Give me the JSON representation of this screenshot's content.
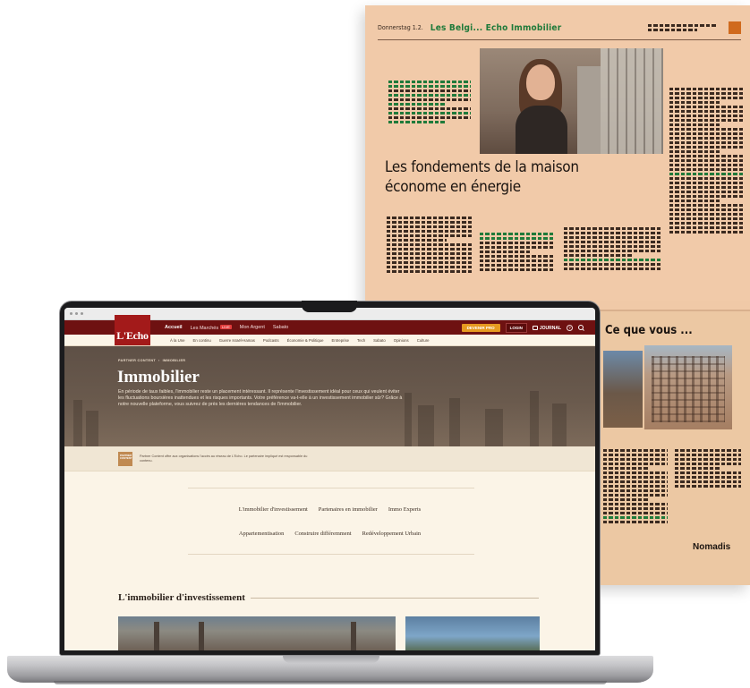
{
  "newspaper": {
    "folio": "Donnerstag 1.2.",
    "kicker": "Les Belgi... Echo Immobilier",
    "headline_line1": "Les fondements de la maison",
    "headline_line2": "économe en énergie",
    "page2_heading": "Ce que vous ...",
    "page2_logo": "Nomadis"
  },
  "browser": {
    "site": {
      "logo": "L'Echo",
      "nav_primary": [
        {
          "label": "Accueil",
          "active": true
        },
        {
          "label": "Les Marchés",
          "badge": "LIVE"
        },
        {
          "label": "Mon Argent"
        },
        {
          "label": "Sabato"
        }
      ],
      "subscribe_label": "DEVENIR PRO",
      "login_label": "LOGIN",
      "journal_label": "JOURNAL",
      "nav_secondary": [
        "À la Une",
        "En continu",
        "Guerre Israël-Hamas",
        "Podcasts",
        "Économie & Politique",
        "Entreprise",
        "Tech",
        "Sabato",
        "Opinions",
        "Culture"
      ],
      "breadcrumb": [
        "PARTNER CONTENT",
        "›",
        "IMMOBILIER"
      ],
      "hero_title": "Immobilier",
      "hero_text": "En période de taux faibles, l'immobilier reste un placement intéressant. Il représente l'investissement idéal pour ceux qui veulent éviter les fluctuations boursières inattendues et les risques importants. Votre préférence va-t-elle à un investissement immobilier sûr? Grâce à notre nouvelle plateforme, vous suivrez de près les dernières tendances de l'immobilier.",
      "partner_badge": "PARTNER CONTENT",
      "partner_text": "Partner Content offre aux organisations l'accès au réseau de L'Echo. Le partenaire impliqué est responsable du contenu.",
      "categories_row1": [
        "L'immobilier d'investissement",
        "Partenaires en immobilier",
        "Immo Experts"
      ],
      "categories_row2": [
        "Appartementisation",
        "Construire différemment",
        "Redéveloppement Urbain"
      ],
      "section_title": "L'immobilier d'investissement"
    }
  },
  "colors": {
    "brand_red": "#6e1111",
    "logo_red": "#a31a1a",
    "subscribe_orange": "#e79a20",
    "page_bg": "#fbf4e7",
    "newspaper_bg": "#f1caa9"
  }
}
